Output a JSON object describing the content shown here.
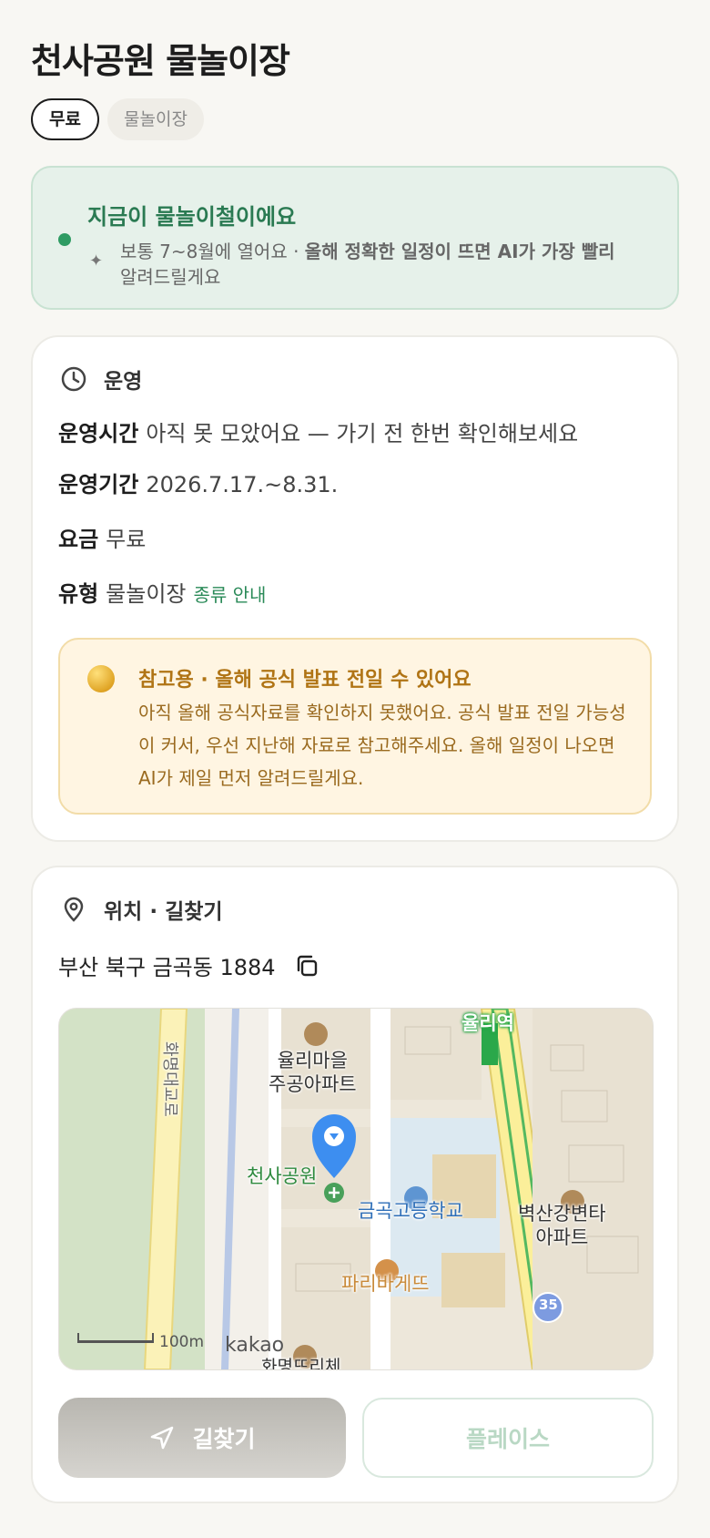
{
  "header": {
    "title": "천사공원 물놀이장",
    "chips": [
      "무료",
      "물놀이장"
    ]
  },
  "season": {
    "title": "지금이 물놀이철이에요",
    "desc_prefix": "보통 7~8월에 열어요 · ",
    "desc_bold": "올해 정확한 일정이 뜨면 AI가 가장 빨리",
    "desc_suffix": "알려드릴게요"
  },
  "operation": {
    "heading": "운영",
    "rows": [
      {
        "label": "운영시간",
        "value": "아직 못 모았어요 — 가기 전 한번 확인해보세요"
      },
      {
        "label": "운영기간",
        "value": "2026.7.17.~8.31."
      },
      {
        "label": "요금",
        "value": "무료"
      },
      {
        "label": "유형",
        "value": "물놀이장",
        "link": "종류 안내"
      }
    ],
    "notice": {
      "title": "참고용 · 올해 공식 발표 전일 수 있어요",
      "body": "아직 올해 공식자료를 확인하지 못했어요. 공식 발표 전일 가능성이 커서, 우선 지난해 자료로 참고해주세요. 올해 일정이 나오면 AI가 제일 먼저 알려드릴게요."
    }
  },
  "location": {
    "heading": "위치 · 길찾기",
    "address": "부산 북구 금곡동 1884",
    "map": {
      "labels": {
        "apt1": "율리마을\n주공아파트",
        "park": "천사공원",
        "school": "금곡고등학교",
        "apt2": "벽산강변타\n아파트",
        "bakery": "파리바게뜨",
        "station": "율리역",
        "road": "화명대교로",
        "route_no": "35",
        "cut": "화명뜨리체"
      },
      "scale": "100m",
      "brand": "kakao"
    },
    "buttons": {
      "route": "길찾기",
      "place": "플레이스"
    }
  }
}
